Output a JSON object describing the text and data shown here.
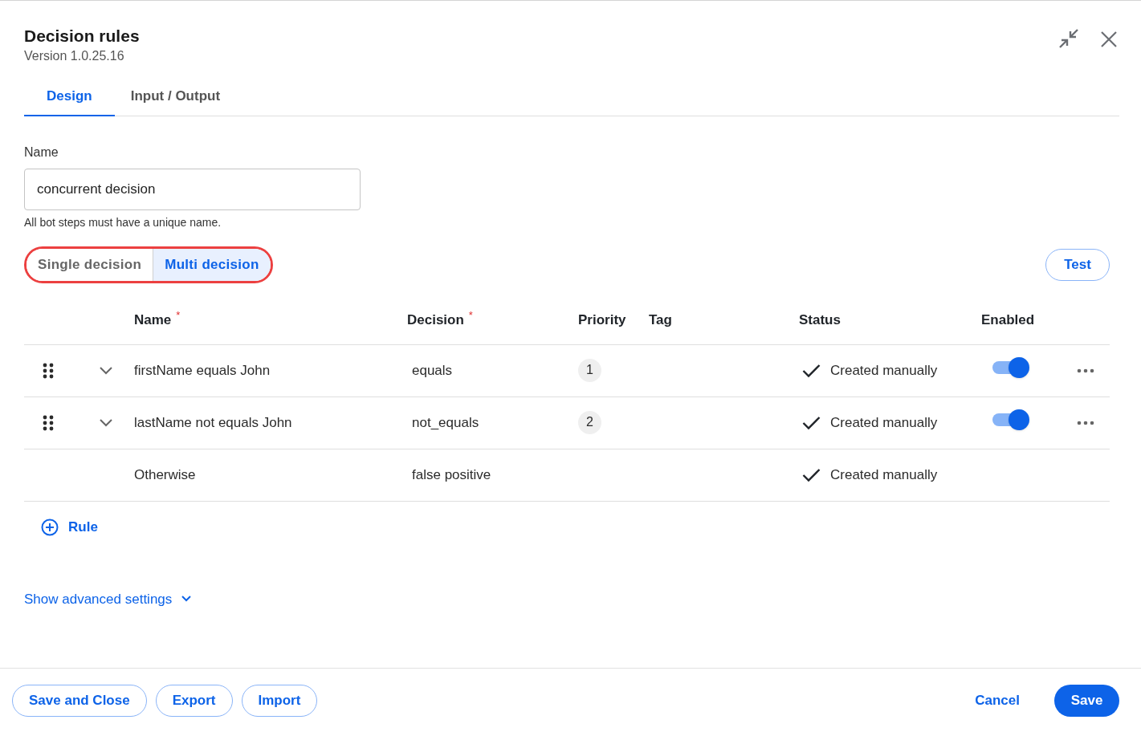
{
  "header": {
    "title": "Decision rules",
    "subtitle": "Version 1.0.25.16"
  },
  "tabs": [
    {
      "label": "Design",
      "selected": true
    },
    {
      "label": "Input / Output",
      "selected": false
    }
  ],
  "name_field": {
    "label": "Name",
    "value": "concurrent decision",
    "hint": "All bot steps must have a unique name."
  },
  "mode_switch": {
    "highlighted": true,
    "options": [
      {
        "label": "Single decision",
        "selected": false
      },
      {
        "label": "Multi decision",
        "selected": true
      }
    ]
  },
  "test_button": "Test",
  "table": {
    "columns": [
      {
        "label": "Name",
        "marker": "*"
      },
      {
        "label": "Decision",
        "marker": "*"
      },
      {
        "label": "Priority"
      },
      {
        "label": "Tag"
      },
      {
        "label": "Status"
      },
      {
        "label": "Enabled"
      }
    ],
    "rows": [
      {
        "kind": "rule",
        "name": "firstName equals John",
        "decision": "equals",
        "priority": "1",
        "status": "Created manually",
        "enabled": true
      },
      {
        "kind": "rule",
        "name": "lastName not equals John",
        "decision": "not_equals",
        "priority": "2",
        "status": "Created manually",
        "enabled": true
      },
      {
        "kind": "default",
        "name": "Otherwise",
        "decision": "false positive",
        "status": "Created manually"
      }
    ]
  },
  "add_rule_button": "Rule",
  "advanced_link": "Show advanced settings",
  "footer": {
    "left_buttons": [
      "Save and Close",
      "Export",
      "Import"
    ],
    "cancel": "Cancel",
    "save": "Save"
  }
}
